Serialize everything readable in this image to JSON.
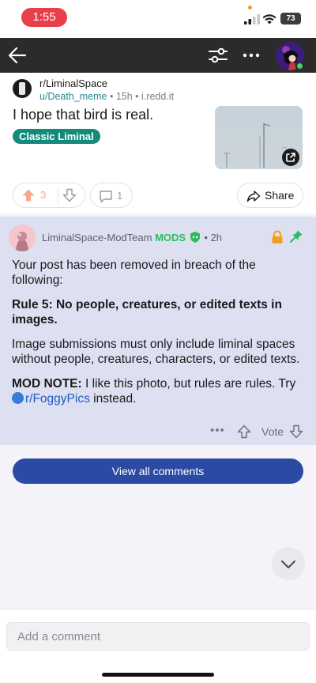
{
  "status_bar": {
    "time": "1:55",
    "battery": "73"
  },
  "post": {
    "subreddit": "r/LiminalSpace",
    "author": "u/Death_meme",
    "age": "15h",
    "domain": "i.redd.it",
    "separator": "•",
    "title": "I hope that bird is real.",
    "flair": "Classic Liminal",
    "vote_count": "3",
    "comment_count": "1",
    "share_label": "Share"
  },
  "mod_comment": {
    "author": "LiminalSpace-ModTeam",
    "badge": "MODS",
    "age": "2h",
    "para1": "Your post has been removed in breach of the following:",
    "rule": "Rule 5: No people, creatures, or edited texts in images.",
    "para3": "Image submissions must only include liminal spaces without people, creatures, characters, or edited texts.",
    "note_label": "MOD NOTE:",
    "note_text": " I like this photo, but rules are rules. Try ",
    "note_link": "r/FoggyPics",
    "note_tail": " instead.",
    "more": "•••",
    "vote_label": "Vote"
  },
  "view_all_label": "View all comments",
  "composer": {
    "placeholder": "Add a comment"
  },
  "colors": {
    "flair": "#138b7c",
    "mods": "#2bbd5a",
    "mod_bg": "#dde0f0",
    "view_all": "#2a4aa3",
    "time_pill": "#e8404a"
  }
}
